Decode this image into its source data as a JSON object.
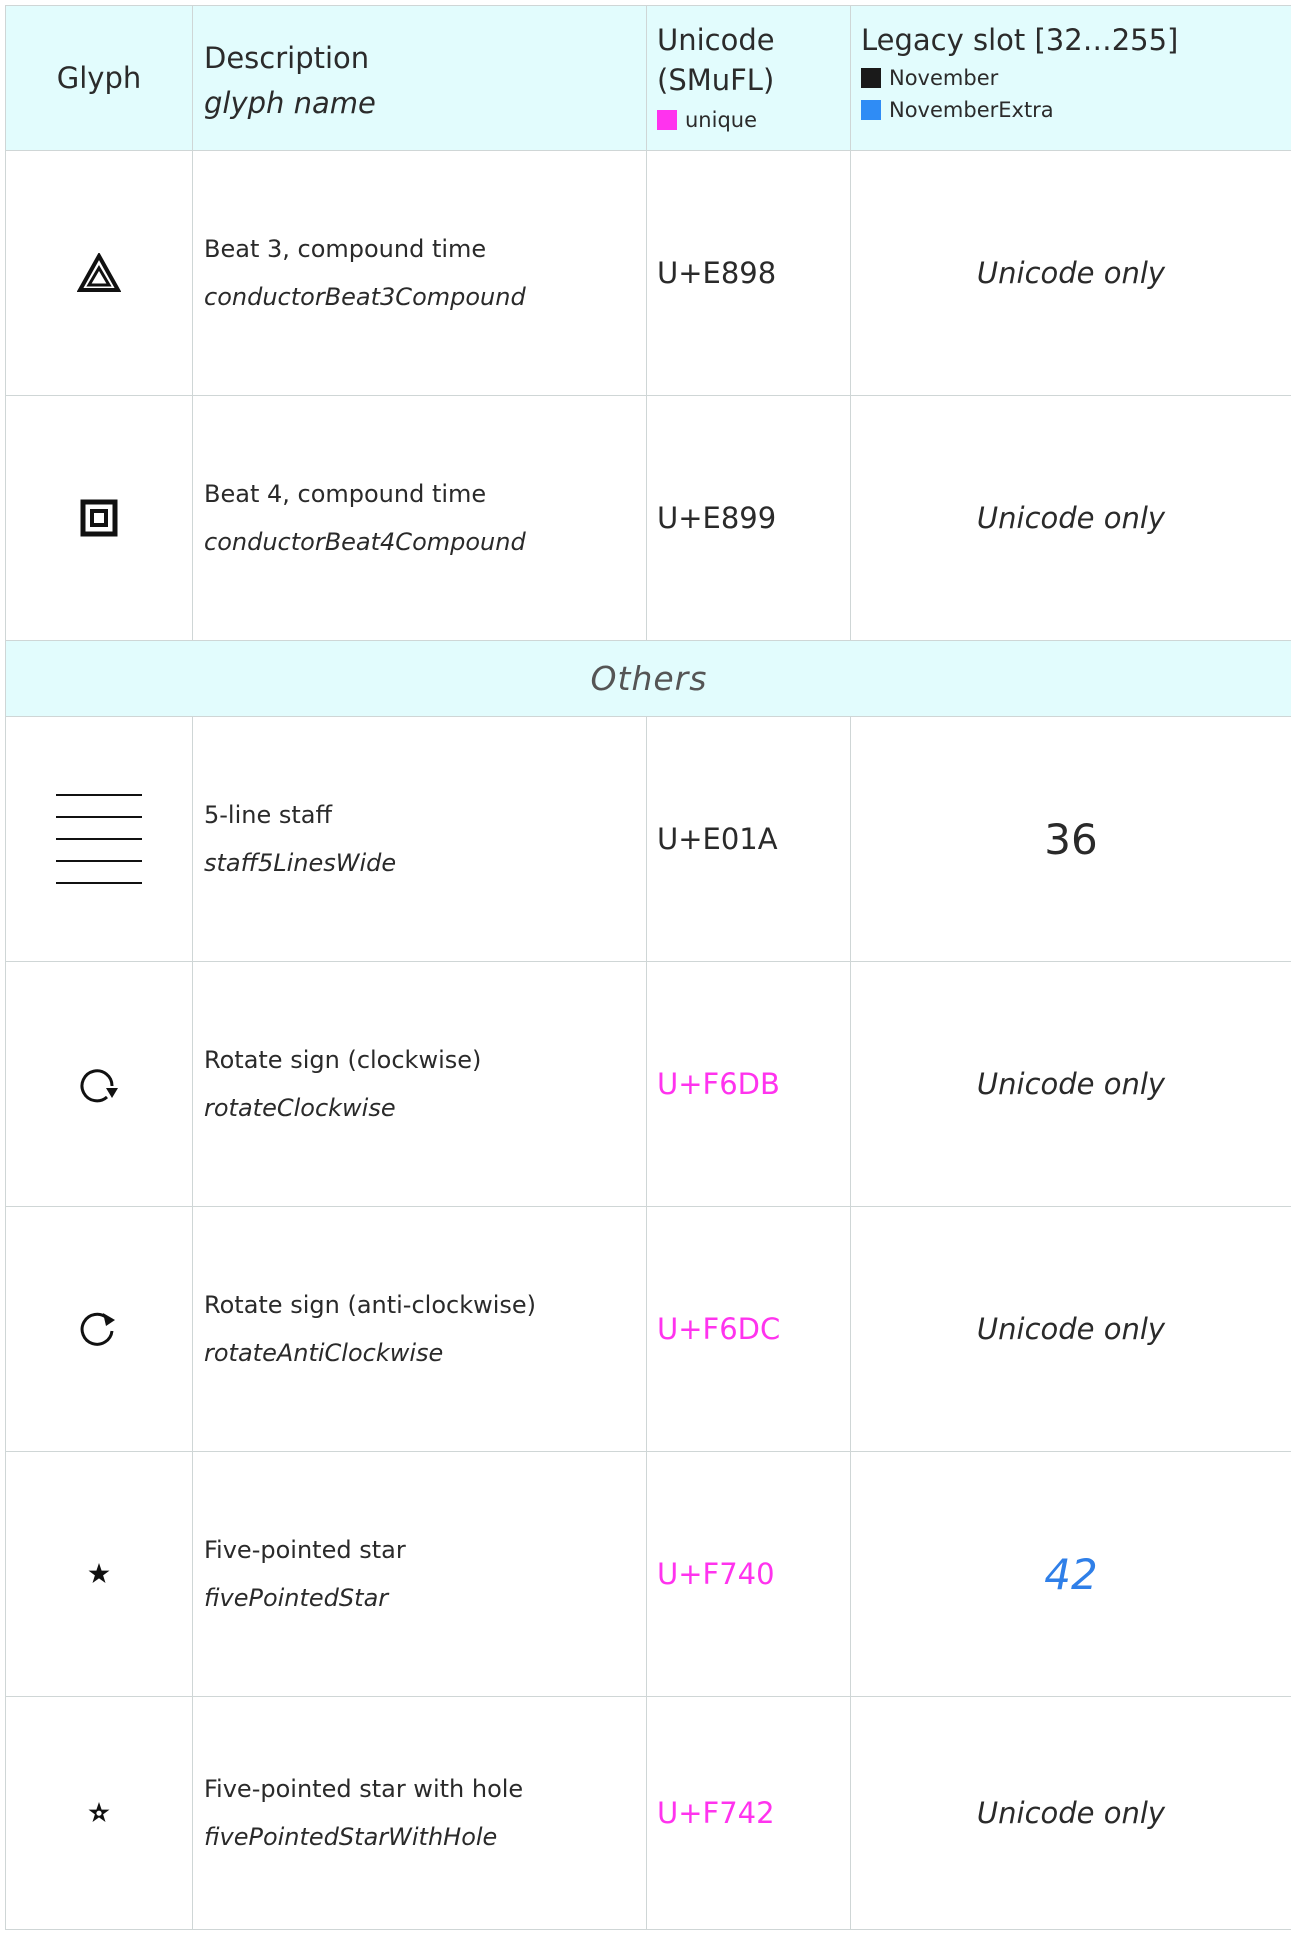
{
  "header": {
    "glyph": "Glyph",
    "description": "Description",
    "glyph_name": "glyph name",
    "unicode_line1": "Unicode",
    "unicode_line2": "(SMuFL)",
    "unique_label": "unique",
    "legacy": "Legacy slot [32…255]",
    "november": "November",
    "november_extra": "NovemberExtra"
  },
  "colors": {
    "header_bg": "#e2fcfd",
    "unique": "#ff33ee",
    "november": "#1a1a1a",
    "november_extra": "#2f8cf5"
  },
  "rows_top": [
    {
      "icon": "triangle-in-triangle-icon",
      "description": "Beat 3, compound time",
      "name": "conductorBeat3Compound",
      "unicode": "U+E898",
      "legacy": "Unicode only"
    },
    {
      "icon": "square-in-square-icon",
      "description": "Beat 4, compound time",
      "name": "conductorBeat4Compound",
      "unicode": "U+E899",
      "legacy": "Unicode only"
    }
  ],
  "section": "Others",
  "rows_others": [
    {
      "icon": "staff-lines-icon",
      "description": "5-line staff",
      "name": "staff5LinesWide",
      "unicode": "U+E01A",
      "legacy": "36"
    },
    {
      "icon": "rotate-clockwise-icon",
      "description": "Rotate sign (clockwise)",
      "name": "rotateClockwise",
      "unicode": "U+F6DB",
      "legacy": "Unicode only"
    },
    {
      "icon": "rotate-anticlockwise-icon",
      "description": "Rotate sign (anti-clockwise)",
      "name": "rotateAntiClockwise",
      "unicode": "U+F6DC",
      "legacy": "Unicode only"
    },
    {
      "icon": "five-pointed-star-icon",
      "description": "Five-pointed star",
      "name": "fivePointedStar",
      "unicode": "U+F740",
      "legacy": "42"
    },
    {
      "icon": "five-pointed-star-hole-icon",
      "description": "Five-pointed star with hole",
      "name": "fivePointedStarWithHole",
      "unicode": "U+F742",
      "legacy": "Unicode only"
    }
  ]
}
